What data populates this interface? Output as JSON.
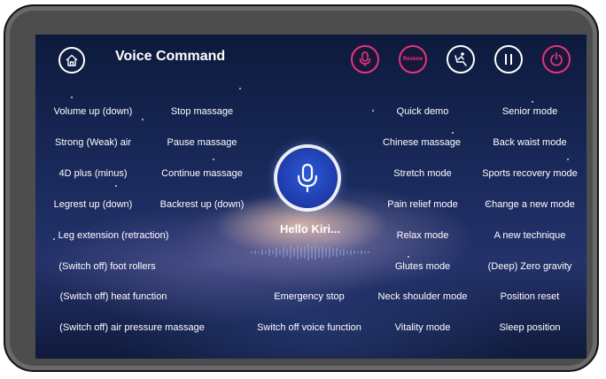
{
  "header": {
    "title": "Voice Command",
    "restore_label": "Restore"
  },
  "hello_text": "Hello Kiri...",
  "commands": {
    "c0": "Volume up (down)",
    "c1": "Stop massage",
    "c2": "Strong (Weak) air",
    "c3": "Pause massage",
    "c4": "4D plus (minus)",
    "c5": "Continue massage",
    "c6": "Legrest up (down)",
    "c7": "Backrest up (down)",
    "c8": "Leg extension (retraction)",
    "c9": "(Switch off) foot rollers",
    "c10": "(Switch off) heat function",
    "c11": "(Switch off) air pressure massage",
    "c12": "Emergency stop",
    "c13": "Switch off voice function",
    "c14": "Quick demo",
    "c15": "Senior mode",
    "c16": "Chinese massage",
    "c17": "Back waist mode",
    "c18": "Stretch mode",
    "c19": "Sports recovery mode",
    "c20": "Pain relief mode",
    "c21": "Change a new mode",
    "c22": "Relax mode",
    "c23": "A new technique",
    "c24": "Glutes mode",
    "c25": "(Deep) Zero gravity",
    "c26": "Neck shoulder mode",
    "c27": "Position reset",
    "c28": "Vitality mode",
    "c29": "Sleep position"
  },
  "colors": {
    "accent_pink": "#e8337f",
    "mic_blue": "#1e3aa8"
  },
  "icons": [
    "home-icon",
    "microphone-icon",
    "restore-icon",
    "massage-chair-icon",
    "pause-icon",
    "power-icon"
  ]
}
